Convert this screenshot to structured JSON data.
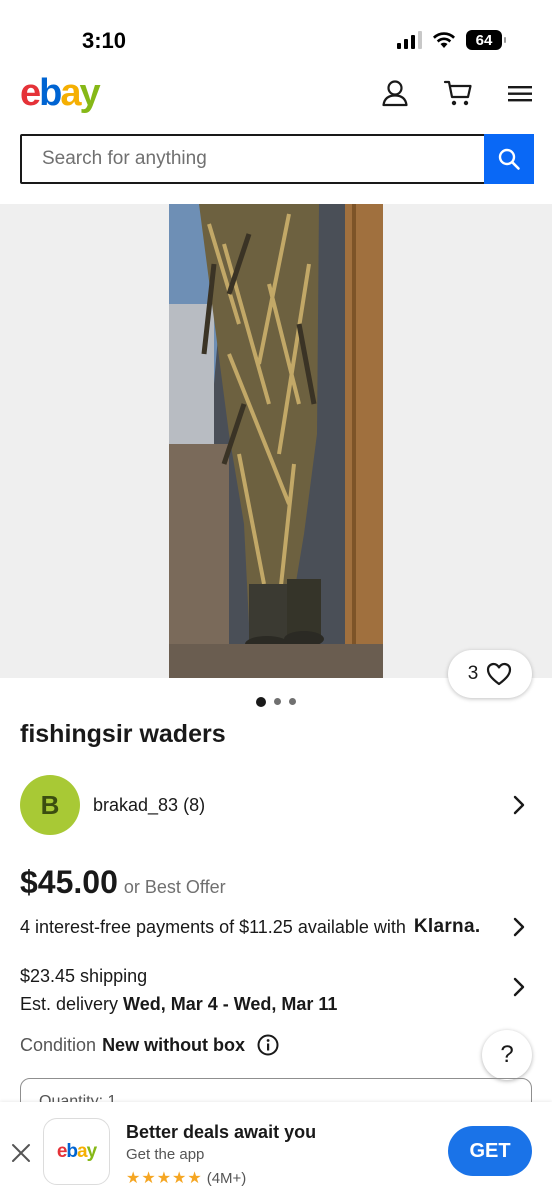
{
  "status_bar": {
    "time": "3:10",
    "battery": "64"
  },
  "header": {
    "logo": {
      "e": "e",
      "b": "b",
      "a": "a",
      "y": "y"
    },
    "icons": [
      "user-icon",
      "cart-icon",
      "menu-icon"
    ]
  },
  "search": {
    "placeholder": "Search for anything"
  },
  "gallery": {
    "watch_count": "3",
    "image_count": 3,
    "active_index": 0
  },
  "listing": {
    "title": "fishingsir waders",
    "seller_initial": "B",
    "seller_name": "brakad_83 (8)",
    "price": "$45.00",
    "best_offer": "or Best Offer",
    "installments": "4 interest-free payments of $11.25 available with",
    "klarna": "Klarna.",
    "shipping": "$23.45 shipping",
    "delivery_prefix": "Est. delivery ",
    "delivery_dates": "Wed, Mar 4 - Wed, Mar 11",
    "condition_label": "Condition",
    "condition_value": "New without box",
    "quantity_text": "Quantity: 1"
  },
  "help": {
    "label": "?"
  },
  "app_banner": {
    "logo": {
      "e": "e",
      "b": "b",
      "a": "a",
      "y": "y"
    },
    "title": "Better deals await you",
    "subtitle": "Get the app",
    "stars": "★★★★★",
    "rating_count": "(4M+)",
    "get_label": "GET"
  },
  "colors": {
    "accent": "#0968f6",
    "avatar": "#a8c935",
    "get_button": "#1a73e8"
  }
}
